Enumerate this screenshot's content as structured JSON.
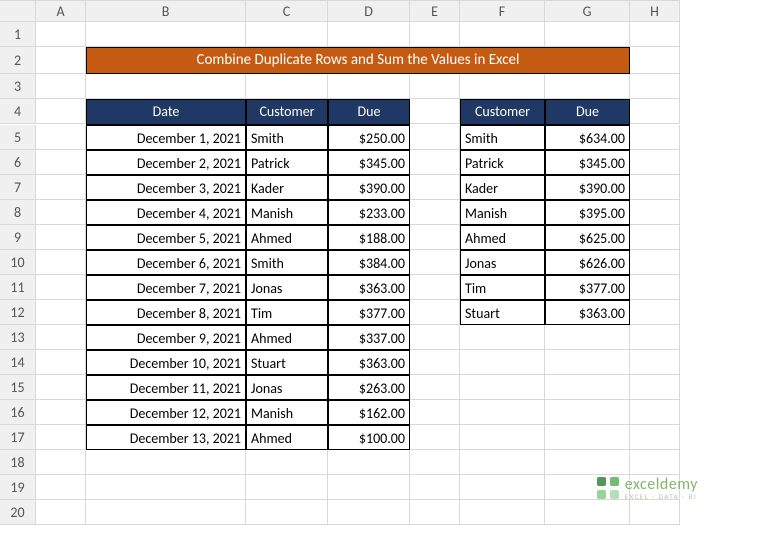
{
  "columns": [
    "A",
    "B",
    "C",
    "D",
    "E",
    "F",
    "G",
    "H"
  ],
  "title": "Combine Duplicate Rows and Sum the Values in Excel",
  "table1": {
    "headers": {
      "date": "Date",
      "customer": "Customer",
      "due": "Due"
    },
    "rows": [
      {
        "date": "December 1, 2021",
        "customer": "Smith",
        "due": "$250.00"
      },
      {
        "date": "December 2, 2021",
        "customer": "Patrick",
        "due": "$345.00"
      },
      {
        "date": "December 3, 2021",
        "customer": "Kader",
        "due": "$390.00"
      },
      {
        "date": "December 4, 2021",
        "customer": "Manish",
        "due": "$233.00"
      },
      {
        "date": "December 5, 2021",
        "customer": "Ahmed",
        "due": "$188.00"
      },
      {
        "date": "December 6, 2021",
        "customer": "Smith",
        "due": "$384.00"
      },
      {
        "date": "December 7, 2021",
        "customer": "Jonas",
        "due": "$363.00"
      },
      {
        "date": "December 8, 2021",
        "customer": "Tim",
        "due": "$377.00"
      },
      {
        "date": "December 9, 2021",
        "customer": "Ahmed",
        "due": "$337.00"
      },
      {
        "date": "December 10, 2021",
        "customer": "Stuart",
        "due": "$363.00"
      },
      {
        "date": "December 11, 2021",
        "customer": "Jonas",
        "due": "$263.00"
      },
      {
        "date": "December 12, 2021",
        "customer": "Manish",
        "due": "$162.00"
      },
      {
        "date": "December 13, 2021",
        "customer": "Ahmed",
        "due": "$100.00"
      }
    ]
  },
  "table2": {
    "headers": {
      "customer": "Customer",
      "due": "Due"
    },
    "rows": [
      {
        "customer": "Smith",
        "due": "$634.00"
      },
      {
        "customer": "Patrick",
        "due": "$345.00"
      },
      {
        "customer": "Kader",
        "due": "$390.00"
      },
      {
        "customer": "Manish",
        "due": "$395.00"
      },
      {
        "customer": "Ahmed",
        "due": "$625.00"
      },
      {
        "customer": "Jonas",
        "due": "$626.00"
      },
      {
        "customer": "Tim",
        "due": "$377.00"
      },
      {
        "customer": "Stuart",
        "due": "$363.00"
      }
    ]
  },
  "brand": {
    "name": "exceldemy",
    "tagline": "EXCEL · DATA · BI"
  }
}
